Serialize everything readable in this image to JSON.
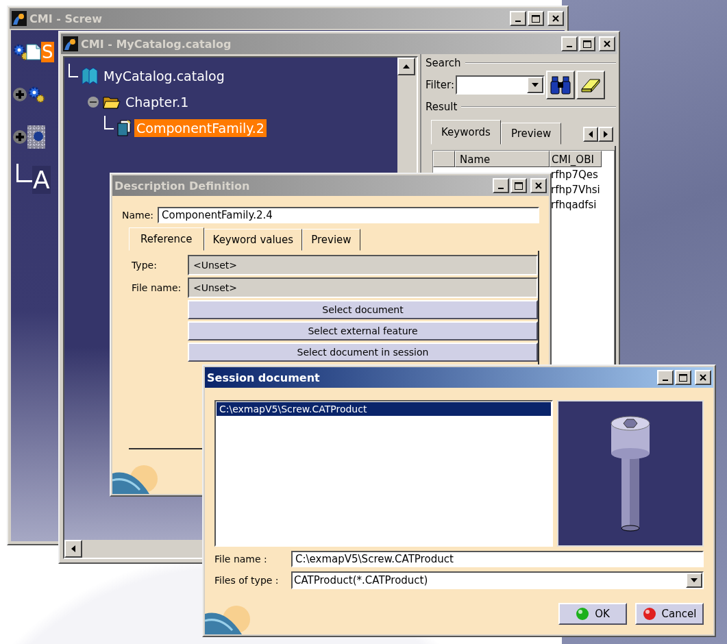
{
  "screw_window": {
    "title": "CMI - Screw",
    "active": false,
    "tree": [
      {
        "kind": "root",
        "label": "S",
        "selected": true
      },
      {
        "kind": "node",
        "expanded": false
      },
      {
        "kind": "node",
        "expanded": false
      },
      {
        "kind": "leaf",
        "label": "A",
        "selected": false
      }
    ]
  },
  "catalog_window": {
    "title": "CMI - MyCatalog.catalog",
    "active": false,
    "tree": [
      {
        "kind": "catalog",
        "label": "MyCatalog.catalog",
        "selected": false,
        "children": [
          {
            "kind": "chapter",
            "label": "Chapter.1",
            "selected": false,
            "expanded": true,
            "children": [
              {
                "kind": "family",
                "label": "ComponentFamily.2",
                "selected": true
              }
            ]
          }
        ]
      }
    ],
    "search": {
      "heading": "Search",
      "filter_label": "Filter:"
    },
    "result": {
      "heading": "Result",
      "tabs": [
        {
          "label": "Keywords",
          "selected": true
        },
        {
          "label": "Preview",
          "selected": false
        }
      ],
      "columns": [
        "Name",
        "CMI_OBI"
      ],
      "rows": [
        [
          "",
          "rfhp7Qes"
        ],
        [
          "",
          "rfhp7Vhsi"
        ],
        [
          "",
          "rfhqadfsi"
        ]
      ]
    }
  },
  "description_dialog": {
    "title": "Description Definition",
    "active": false,
    "name_label": "Name:",
    "name_value": "ComponentFamily.2.4",
    "tabs": [
      {
        "label": "Reference",
        "selected": true
      },
      {
        "label": "Keyword values",
        "selected": false
      },
      {
        "label": "Preview",
        "selected": false
      }
    ],
    "fields": [
      {
        "label": "Type:",
        "value": "<Unset>"
      },
      {
        "label": "File name:",
        "value": "<Unset>"
      }
    ],
    "buttons": [
      "Select document",
      "Select external feature",
      "Select document in session"
    ]
  },
  "session_dialog": {
    "title": "Session document",
    "active": true,
    "files": [
      {
        "path": "C:\\exmapV5\\Screw.CATProduct",
        "selected": true
      }
    ],
    "file_name_label": "File name :",
    "file_name_value": "C:\\exmapV5\\Screw.CATProduct",
    "type_label": "Files of type :",
    "type_value": "CATProduct(*.CATProduct)",
    "buttons": [
      {
        "label": "OK",
        "kind": "ok"
      },
      {
        "label": "Cancel",
        "kind": "cancel"
      }
    ]
  }
}
